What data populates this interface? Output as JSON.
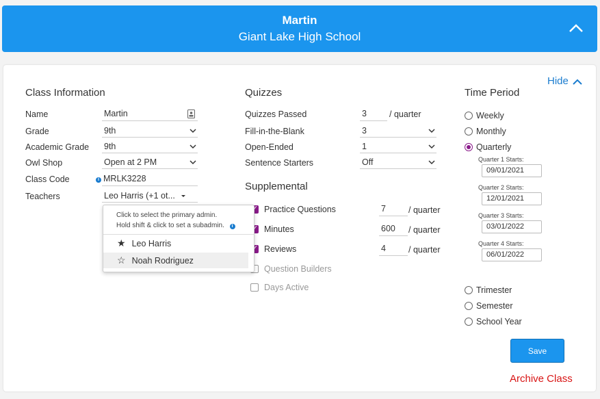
{
  "header": {
    "name": "Martin",
    "school": "Giant Lake High School"
  },
  "hide_label": "Hide",
  "class_info": {
    "title": "Class Information",
    "name_label": "Name",
    "name_value": "Martin",
    "grade_label": "Grade",
    "grade_value": "9th",
    "academic_grade_label": "Academic Grade",
    "academic_grade_value": "9th",
    "owl_shop_label": "Owl Shop",
    "owl_shop_value": "Open at 2 PM",
    "class_code_label": "Class Code",
    "class_code_value": "MRLK3228",
    "teachers_label": "Teachers",
    "teachers_value": "Leo Harris (+1 ot..."
  },
  "teacher_dropdown": {
    "hint_line1": "Click to select the primary admin.",
    "hint_line2": "Hold shift & click to set a subadmin.",
    "options": [
      {
        "name": "Leo Harris",
        "icon": "star-filled"
      },
      {
        "name": "Noah Rodriguez",
        "icon": "star-outline"
      }
    ]
  },
  "quizzes": {
    "title": "Quizzes",
    "passed_label": "Quizzes Passed",
    "passed_value": "3",
    "passed_unit": "/ quarter",
    "fill_label": "Fill-in-the-Blank",
    "fill_value": "3",
    "open_label": "Open-Ended",
    "open_value": "1",
    "starters_label": "Sentence Starters",
    "starters_value": "Off"
  },
  "supplemental": {
    "title": "Supplemental",
    "items": [
      {
        "label": "Practice Questions",
        "checked": true,
        "value": "7",
        "unit": "/ quarter"
      },
      {
        "label": "Minutes",
        "checked": true,
        "value": "600",
        "unit": "/ quarter"
      },
      {
        "label": "Reviews",
        "checked": true,
        "value": "4",
        "unit": "/ quarter"
      },
      {
        "label": "Question Builders",
        "checked": false
      },
      {
        "label": "Days Active",
        "checked": false
      }
    ]
  },
  "time_period": {
    "title": "Time Period",
    "options": [
      "Weekly",
      "Monthly",
      "Quarterly",
      "Trimester",
      "Semester",
      "School Year"
    ],
    "selected": "Quarterly",
    "quarters": [
      {
        "label": "Quarter 1 Starts:",
        "date": "09/01/2021"
      },
      {
        "label": "Quarter 2 Starts:",
        "date": "12/01/2021"
      },
      {
        "label": "Quarter 3 Starts:",
        "date": "03/01/2022"
      },
      {
        "label": "Quarter 4 Starts:",
        "date": "06/01/2022"
      }
    ]
  },
  "save_label": "Save",
  "archive_label": "Archive Class",
  "colors": {
    "primary": "#1b95ee",
    "accent": "#8a1a8a",
    "danger": "#d81414"
  }
}
